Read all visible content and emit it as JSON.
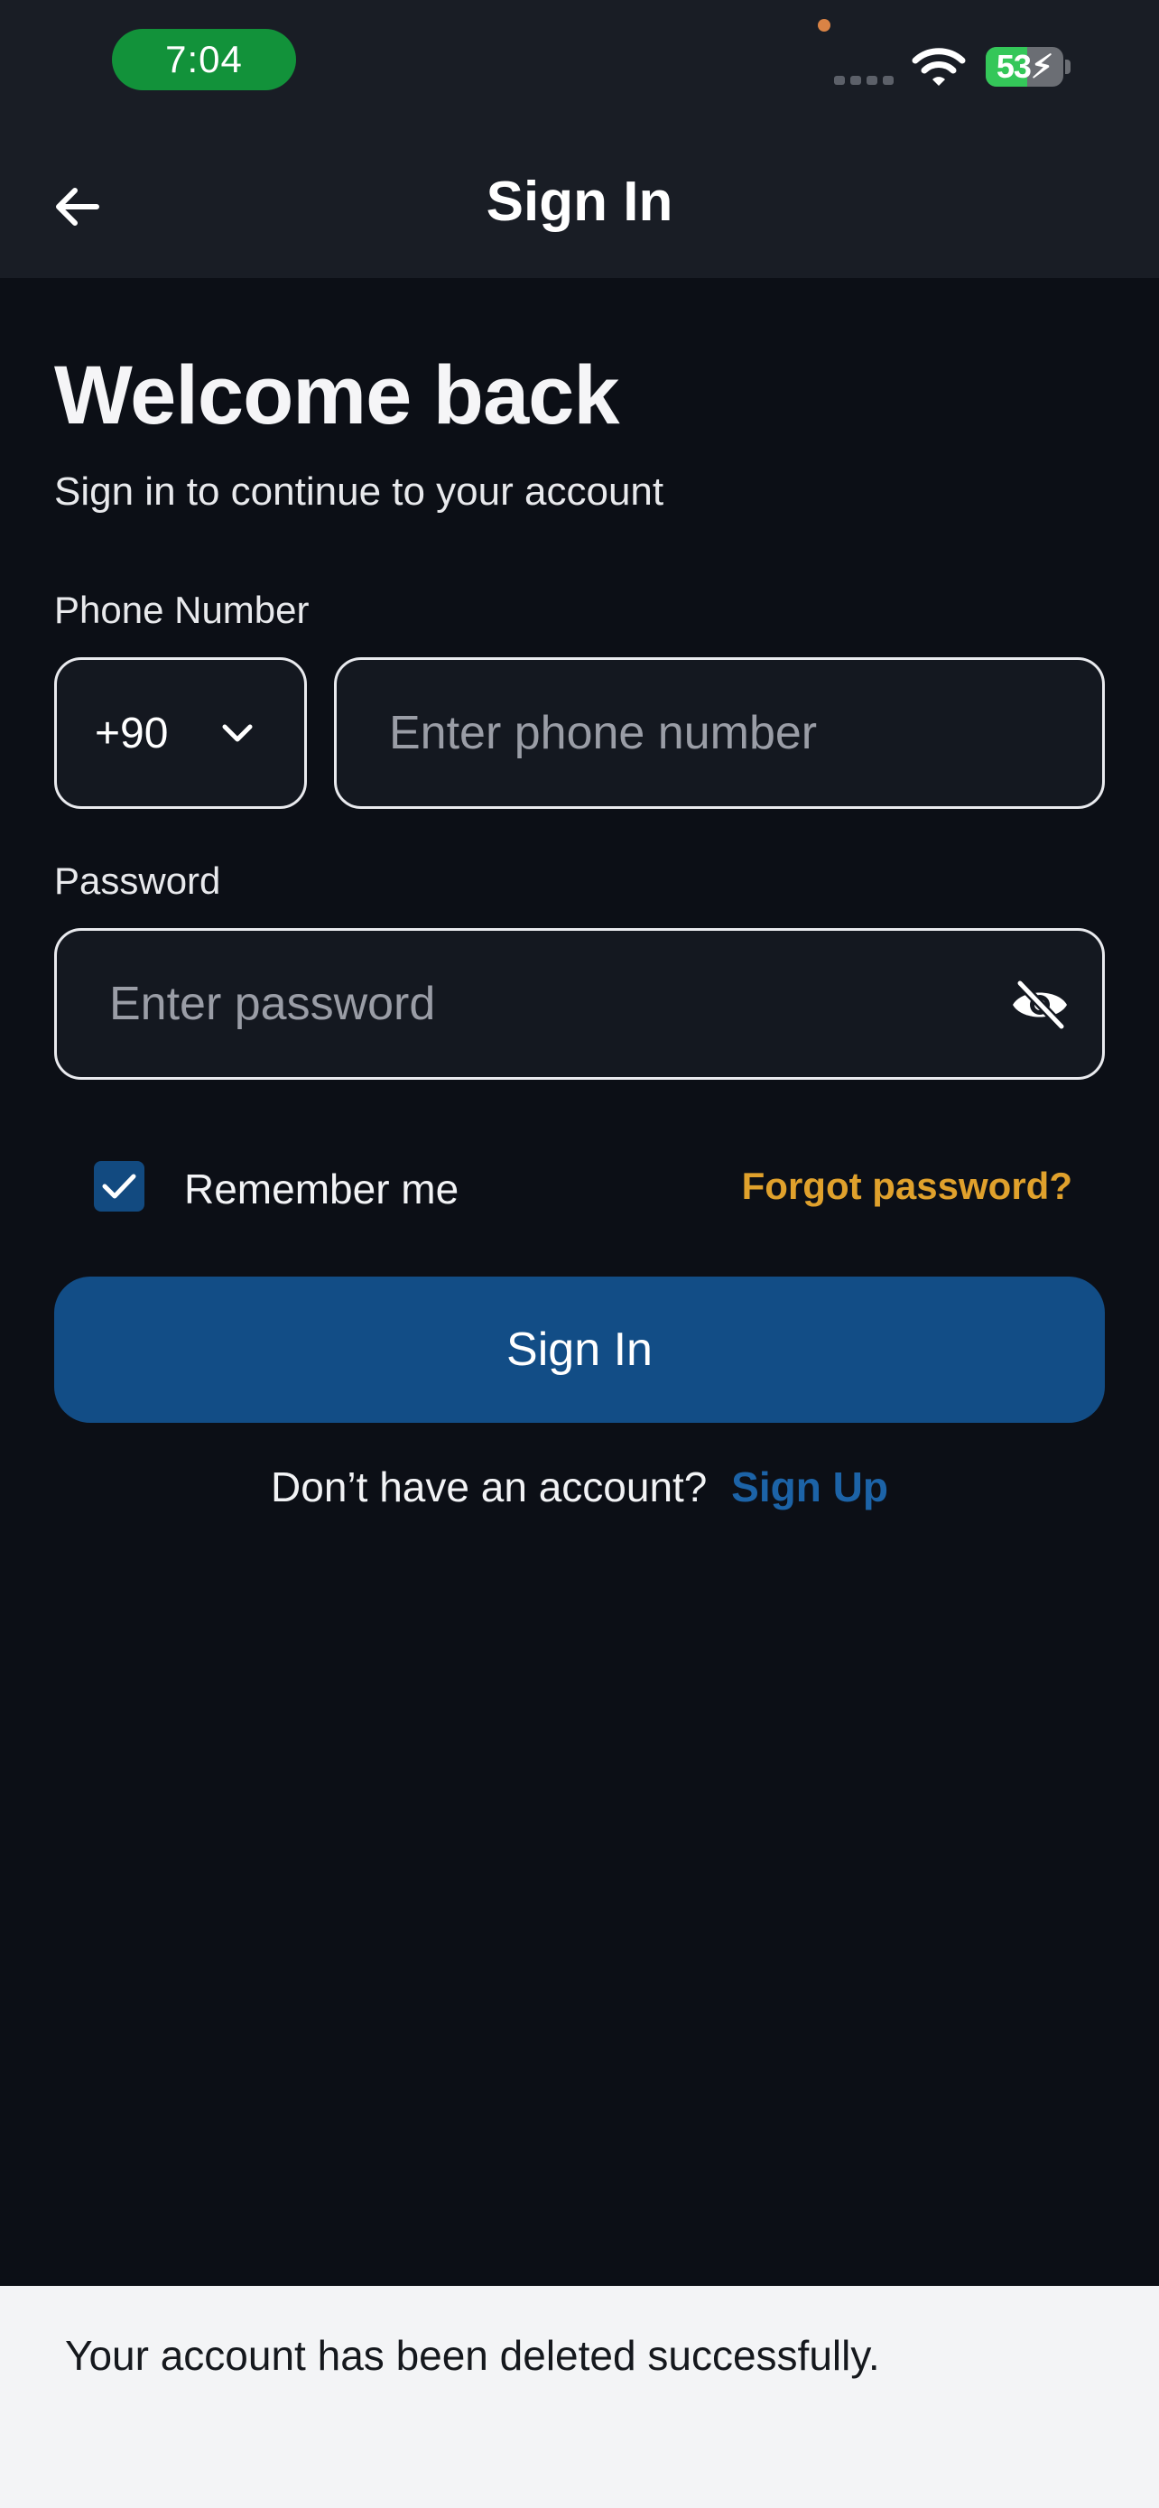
{
  "status_bar": {
    "time": "7:04",
    "battery_percent": "53",
    "battery_level": 0.53
  },
  "header": {
    "title": "Sign In",
    "back_icon": "arrow-left-icon"
  },
  "content": {
    "heading": "Welcome back",
    "subtitle": "Sign in to continue to your account",
    "phone": {
      "label": "Phone Number",
      "country_code": "+90",
      "placeholder": "Enter phone number",
      "value": ""
    },
    "password": {
      "label": "Password",
      "placeholder": "Enter password",
      "value": "",
      "toggle_icon": "eye-off-icon"
    },
    "remember_me": {
      "label": "Remember me",
      "checked": true
    },
    "forgot_password": "Forgot password?",
    "sign_in_button": "Sign In",
    "signup_prompt": "Don’t have an account?",
    "signup_link": "Sign Up"
  },
  "toast": {
    "message": "Your account has been deleted successfully."
  },
  "colors": {
    "background": "#0c0f16",
    "header": "#191d25",
    "primary": "#124d86",
    "link": "#1c63a7",
    "accent": "#e0a12c",
    "toast_bg": "#f3f4f6"
  }
}
